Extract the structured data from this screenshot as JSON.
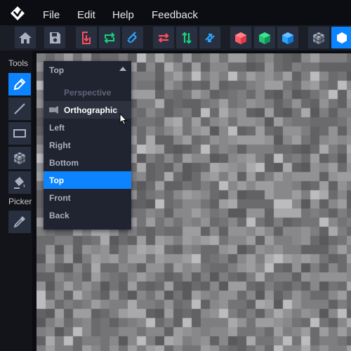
{
  "menubar": {
    "items": [
      "File",
      "Edit",
      "Help",
      "Feedback"
    ]
  },
  "toolbar": {
    "buttons": [
      {
        "icon": "home-icon",
        "color": "#aab0be"
      },
      {
        "icon": "save-icon",
        "color": "#aab0be"
      },
      {
        "icon": "import-icon",
        "color": "#ff4d5e"
      },
      {
        "icon": "repeat-icon",
        "color": "#19d27a"
      },
      {
        "icon": "rotate-icon",
        "color": "#2aa3ff"
      },
      {
        "icon": "swap-horizontal-icon",
        "color": "#ff4d5e"
      },
      {
        "icon": "swap-vertical-icon",
        "color": "#19d27a"
      },
      {
        "icon": "sync-icon",
        "color": "#2aa3ff"
      },
      {
        "icon": "cube-red-icon",
        "color": "#ff4d5e"
      },
      {
        "icon": "cube-green-icon",
        "color": "#19d27a"
      },
      {
        "icon": "cube-blue-icon",
        "color": "#2aa3ff"
      },
      {
        "icon": "cube-grid-icon",
        "color": "#aab0be"
      },
      {
        "icon": "hexagon-icon",
        "color": "#ffffff"
      }
    ]
  },
  "sidebar": {
    "tools_label": "Tools",
    "picker_label": "Picker",
    "tools": [
      "pencil-icon",
      "line-icon",
      "rectangle-icon",
      "cube-brush-icon",
      "fill-bucket-icon"
    ],
    "picker": [
      "eyedropper-icon"
    ]
  },
  "view_dropdown": {
    "current": "Top",
    "group_label": "Perspective",
    "options": [
      "Orthographic",
      "Left",
      "Right",
      "Bottom",
      "Top",
      "Front",
      "Back"
    ],
    "hovered": "Orthographic",
    "selected": "Top"
  },
  "colors": {
    "accent": "#0d84ff",
    "danger": "#ff4d5e",
    "success": "#19d27a",
    "info": "#2aa3ff"
  }
}
